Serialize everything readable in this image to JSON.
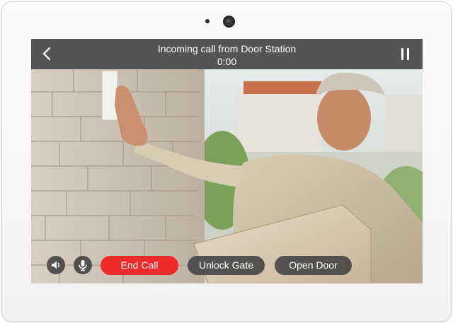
{
  "device": {
    "sensor_icon": "sensor-dot",
    "camera_icon": "camera-lens"
  },
  "call": {
    "title": "Incoming call from Door Station",
    "timer": "0:00",
    "back_icon": "chevron-left-icon",
    "pause_icon": "pause-icon"
  },
  "controls": {
    "speaker_icon": "speaker-icon",
    "microphone_icon": "microphone-icon",
    "end_call_label": "End Call",
    "unlock_gate_label": "Unlock Gate",
    "open_door_label": "Open Door"
  },
  "colors": {
    "end_call": "#ef2a2a",
    "bar": "#464646",
    "text": "#ffffff"
  }
}
